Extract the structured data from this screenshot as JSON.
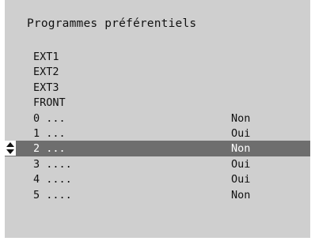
{
  "title": "Programmes préférentiels",
  "selected_index": 6,
  "items": [
    {
      "label": "EXT1",
      "value": ""
    },
    {
      "label": "EXT2",
      "value": ""
    },
    {
      "label": "EXT3",
      "value": ""
    },
    {
      "label": "FRONT",
      "value": ""
    },
    {
      "label": "0 ...",
      "value": "Non"
    },
    {
      "label": "1 ...",
      "value": "Oui"
    },
    {
      "label": "2 ...",
      "value": "Non"
    },
    {
      "label": "3 ....",
      "value": "Oui"
    },
    {
      "label": "4 ....",
      "value": "Oui"
    },
    {
      "label": "5 ....",
      "value": "Non"
    }
  ],
  "icons": {
    "selector": "up-down-arrows-icon"
  }
}
